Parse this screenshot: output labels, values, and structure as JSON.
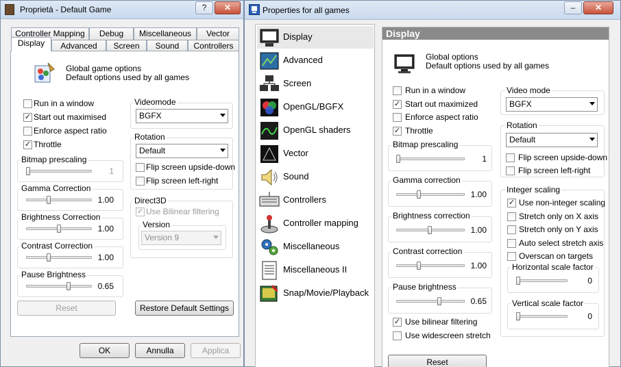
{
  "left_window": {
    "title": "Proprietà - Default Game",
    "help_label": "?",
    "close_label": "✕",
    "tabs_row1": [
      "Controller Mapping",
      "Debug",
      "Miscellaneous",
      "Vector"
    ],
    "tabs_row2": [
      "Display",
      "Advanced",
      "Screen",
      "Sound",
      "Controllers"
    ],
    "selected_tab": "Display",
    "global_line1": "Global game options",
    "global_line2": "Default options used by all games",
    "checks": [
      {
        "label": "Run in a window",
        "checked": false
      },
      {
        "label": "Start out maximised",
        "checked": true
      },
      {
        "label": "Enforce aspect ratio",
        "checked": false
      },
      {
        "label": "Throttle",
        "checked": true
      }
    ],
    "sliders": [
      {
        "label": "Bitmap prescaling",
        "value": "1",
        "pos": 0.0
      },
      {
        "label": "Gamma Correction",
        "value": "1.00",
        "pos": 0.33
      },
      {
        "label": "Brightness Correction",
        "value": "1.00",
        "pos": 0.5
      },
      {
        "label": "Contrast Correction",
        "value": "1.00",
        "pos": 0.33
      },
      {
        "label": "Pause Brightness",
        "value": "0.65",
        "pos": 0.65
      }
    ],
    "videomode": {
      "title": "Videomode",
      "value": "BGFX"
    },
    "rotation": {
      "title": "Rotation",
      "value": "Default",
      "flip_ud": "Flip screen upside-down",
      "flip_lr": "Flip screen left-right"
    },
    "direct3d": {
      "title": "Direct3D",
      "bilinear": "Use Bilinear filtering",
      "version_title": "Version",
      "version_value": "Version 9"
    },
    "reset_label": "Reset",
    "restore_label": "Restore Default Settings",
    "ok_label": "OK",
    "cancel_label": "Annulla",
    "apply_label": "Applica"
  },
  "right_window": {
    "title": "Properties for all games",
    "minimize_label": "–",
    "close_label": "✕",
    "nav_items": [
      {
        "label": "Display",
        "icon": "monitor-icon"
      },
      {
        "label": "Advanced",
        "icon": "advanced-icon"
      },
      {
        "label": "Screen",
        "icon": "network-screen-icon"
      },
      {
        "label": "OpenGL/BGFX",
        "icon": "opengl-icon"
      },
      {
        "label": "OpenGL shaders",
        "icon": "shader-icon"
      },
      {
        "label": "Vector",
        "icon": "vector-icon"
      },
      {
        "label": "Sound",
        "icon": "speaker-icon"
      },
      {
        "label": "Controllers",
        "icon": "keyboard-icon"
      },
      {
        "label": "Controller mapping",
        "icon": "joystick-icon"
      },
      {
        "label": "Miscellaneous",
        "icon": "gears-icon"
      },
      {
        "label": "Miscellaneous II",
        "icon": "document-icon"
      },
      {
        "label": "Snap/Movie/Playback",
        "icon": "snapshot-icon"
      }
    ],
    "selected_nav": "Display",
    "header": "Display",
    "global_line1": "Global options",
    "global_line2": "Default options used by all games",
    "checks": [
      {
        "label": "Run in a window",
        "checked": false
      },
      {
        "label": "Start out maximized",
        "checked": true
      },
      {
        "label": "Enforce aspect ratio",
        "checked": false
      },
      {
        "label": "Throttle",
        "checked": true
      }
    ],
    "sliders": [
      {
        "label": "Bitmap prescaling",
        "value": "1",
        "pos": 0.0
      },
      {
        "label": "Gamma correction",
        "value": "1.00",
        "pos": 0.33
      },
      {
        "label": "Brightness correction",
        "value": "1.00",
        "pos": 0.5
      },
      {
        "label": "Contrast correction",
        "value": "1.00",
        "pos": 0.33
      },
      {
        "label": "Pause brightness",
        "value": "0.65",
        "pos": 0.65
      }
    ],
    "bottom_checks": [
      {
        "label": "Use bilinear filtering",
        "checked": true
      },
      {
        "label": "Use widescreen stretch",
        "checked": false
      }
    ],
    "reset_label": "Reset",
    "videomode": {
      "title": "Video mode",
      "value": "BGFX"
    },
    "rotation": {
      "title": "Rotation",
      "value": "Default",
      "flip_ud": "Flip screen upside-down",
      "flip_lr": "Flip screen left-right"
    },
    "integer_scaling": {
      "title": "Integer scaling",
      "checks": [
        {
          "label": "Use non-integer scaling",
          "checked": true
        },
        {
          "label": "Stretch only on X axis",
          "checked": false
        },
        {
          "label": "Stretch only on Y axis",
          "checked": false
        },
        {
          "label": "Auto select stretch axis",
          "checked": false
        },
        {
          "label": "Overscan on targets",
          "checked": false
        }
      ],
      "h_title": "Horizontal scale factor",
      "h_value": "0",
      "v_title": "Vertical scale factor",
      "v_value": "0"
    }
  },
  "colors": {
    "header_bg": "#8a8a8a",
    "title_bar": "#c9d9ee",
    "close_btn": "#c8523b"
  }
}
